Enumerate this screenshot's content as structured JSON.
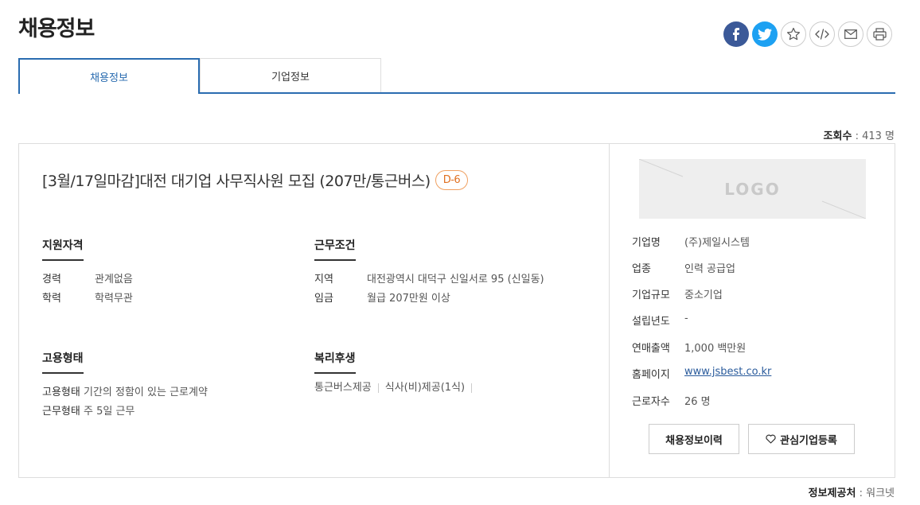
{
  "page": {
    "title": "채용정보"
  },
  "share": {
    "facebook_icon": "facebook-icon",
    "twitter_icon": "twitter-icon",
    "star_icon": "star-icon",
    "embed_icon": "code-icon",
    "mail_icon": "mail-icon",
    "print_icon": "print-icon"
  },
  "tabs": [
    {
      "label": "채용정보",
      "active": true
    },
    {
      "label": "기업정보",
      "active": false
    }
  ],
  "view_count": {
    "label": "조회수",
    "sep": " : ",
    "value": "413 명"
  },
  "job": {
    "title": "[3월/17일마감]대전 대기업 사무직사원 모집 (207만/통근버스)",
    "dday": "D-6"
  },
  "qualification": {
    "heading": "지원자격",
    "rows": [
      {
        "key": "경력",
        "value": "관계없음"
      },
      {
        "key": "학력",
        "value": "학력무관"
      }
    ]
  },
  "conditions": {
    "heading": "근무조건",
    "rows": [
      {
        "key": "지역",
        "value": "대전광역시 대덕구 신일서로 95 (신일동)"
      },
      {
        "key": "임금",
        "value": "월급 207만원 이상"
      }
    ]
  },
  "employment": {
    "heading": "고용형태",
    "rows": [
      {
        "key": "고용형태",
        "value": "기간의 정함이 있는 근로계약"
      },
      {
        "key": "근무형태",
        "value": "주 5일 근무"
      }
    ]
  },
  "welfare": {
    "heading": "복리후생",
    "items": [
      "통근버스제공",
      "식사(비)제공(1식)"
    ]
  },
  "company": {
    "logo_text": "LOGO",
    "rows": [
      {
        "key": "기업명",
        "value": "(주)제일시스템"
      },
      {
        "key": "업종",
        "value": "인력 공급업"
      },
      {
        "key": "기업규모",
        "value": "중소기업"
      },
      {
        "key": "설립년도",
        "value": "-"
      },
      {
        "key": "연매출액",
        "value": "1,000 백만원"
      },
      {
        "key": "홈페이지",
        "value": "www.jsbest.co.kr"
      },
      {
        "key": "근로자수",
        "value": "26 명"
      }
    ],
    "history_button": "채용정보이력",
    "favorite_button": "관심기업등록"
  },
  "source": {
    "label": "정보제공처",
    "sep": " : ",
    "value": "워크넷"
  },
  "colors": {
    "accent": "#2a6cb0",
    "dday": "#e07020",
    "facebook": "#3b5998",
    "twitter": "#1da1f2"
  }
}
